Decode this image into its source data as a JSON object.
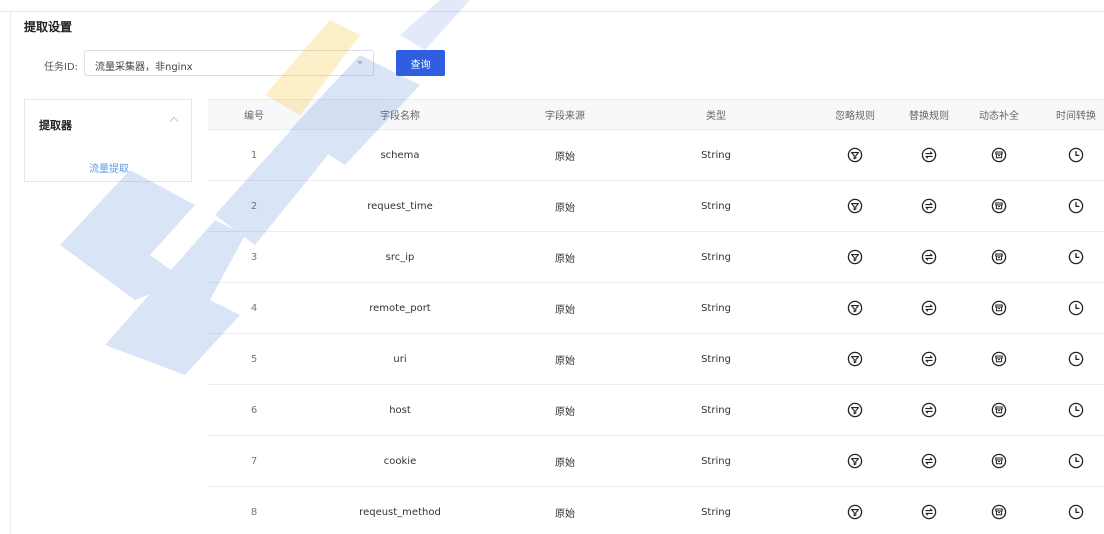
{
  "page": {
    "section_title": "提取设置"
  },
  "filter": {
    "label": "任务ID:",
    "selected": "流量采集器，非nginx",
    "query_button": "查询"
  },
  "extractor": {
    "title": "提取器",
    "items": [
      {
        "label": "流量提取"
      }
    ]
  },
  "table": {
    "headers": {
      "num": "编号",
      "name": "字段名称",
      "source": "字段来源",
      "type": "类型",
      "ignore_rule": "忽略规则",
      "replace_rule": "替换规则",
      "dynamic_fill": "动态补全",
      "time_convert": "时间转换"
    },
    "rows": [
      {
        "num": "1",
        "name": "schema",
        "source": "原始",
        "type": "String"
      },
      {
        "num": "2",
        "name": "request_time",
        "source": "原始",
        "type": "String"
      },
      {
        "num": "3",
        "name": "src_ip",
        "source": "原始",
        "type": "String"
      },
      {
        "num": "4",
        "name": "remote_port",
        "source": "原始",
        "type": "String"
      },
      {
        "num": "5",
        "name": "uri",
        "source": "原始",
        "type": "String"
      },
      {
        "num": "6",
        "name": "host",
        "source": "原始",
        "type": "String"
      },
      {
        "num": "7",
        "name": "cookie",
        "source": "原始",
        "type": "String"
      },
      {
        "num": "8",
        "name": "reqeust_method",
        "source": "原始",
        "type": "String"
      }
    ],
    "row_icons": {
      "ignore": "filter-icon",
      "replace": "swap-icon",
      "dynamic": "archive-icon",
      "time": "clock-icon"
    }
  },
  "colors": {
    "primary": "#2f5fe0",
    "link": "#5b9be6",
    "watermark_blue": "#3a6fd6",
    "watermark_yellow": "#f5b400"
  }
}
